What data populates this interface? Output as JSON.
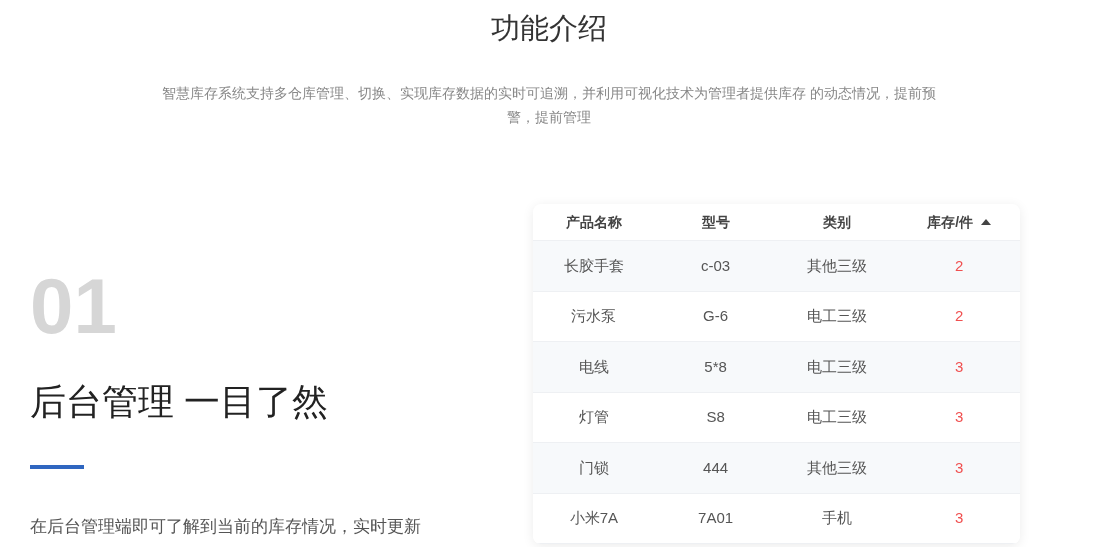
{
  "section_title": "功能介绍",
  "intro": "智慧库存系统支持多仓库管理、切换、实现库存数据的实时可追溯，并利用可视化技术为管理者提供库存 的动态情况，提前预警，提前管理",
  "feature": {
    "number": "01",
    "heading": "后台管理 一目了然",
    "description": "在后台管理端即可了解到当前的库存情况，实时更新"
  },
  "table": {
    "columns": [
      {
        "label": "产品名称",
        "kind": "text"
      },
      {
        "label": "型号",
        "kind": "text"
      },
      {
        "label": "类别",
        "kind": "text"
      },
      {
        "label": "库存/件",
        "kind": "stock",
        "sort_ascending": true
      }
    ],
    "rows": [
      [
        "长胶手套",
        "c-03",
        "其他三级",
        "2"
      ],
      [
        "污水泵",
        "G-6",
        "电工三级",
        "2"
      ],
      [
        "电线",
        "5*8",
        "电工三级",
        "3"
      ],
      [
        "灯管",
        "S8",
        "电工三级",
        "3"
      ],
      [
        "门锁",
        "444",
        "其他三级",
        "3"
      ],
      [
        "小米7A",
        "7A01",
        "手机",
        "3"
      ]
    ]
  }
}
